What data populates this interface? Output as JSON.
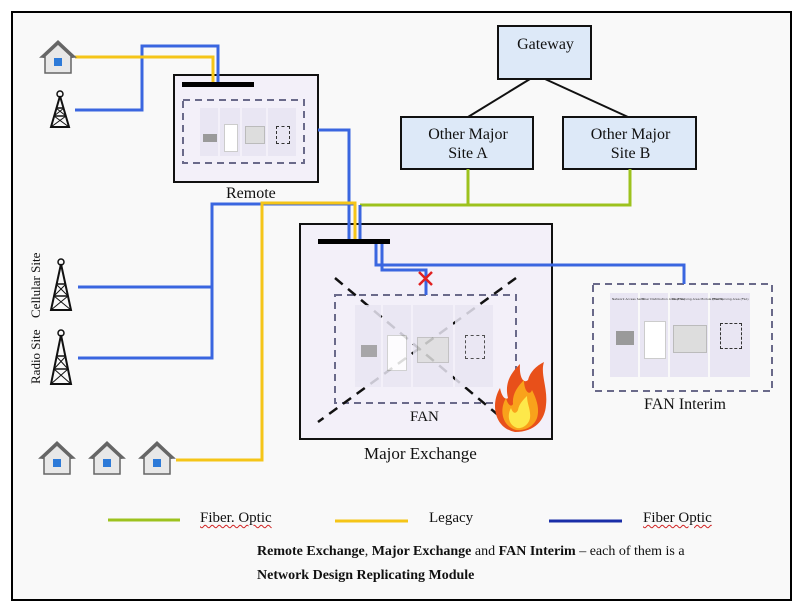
{
  "nodes": {
    "gateway": "Gateway",
    "site_a": [
      "Other Major",
      "Site A"
    ],
    "site_b": [
      "Other Major",
      "Site B"
    ],
    "remote": "Remote",
    "major_exchange": "Major Exchange",
    "fan": "FAN",
    "fan_interim": "FAN Interim",
    "cellular_site": "Cellular Site",
    "radio_site": "Radio Site"
  },
  "module_columns": [
    "Network Access Seite",
    "Fiber Distribution Area (FDA)",
    "Fiber Serving Area Module (FSAM)",
    "Fiber Serving Area (FSA)"
  ],
  "legend": [
    {
      "label": "Fiber. Optic",
      "color": "#9dc21e"
    },
    {
      "label": "Legacy",
      "color": "#f5c518"
    },
    {
      "label": "Fiber Optic",
      "color": "#1a2ea8"
    }
  ],
  "caption": {
    "part1_bold": "Remote Exchange",
    "sep1": ", ",
    "part2_bold": "Major Exchange",
    "and": " and ",
    "part3_bold": "FAN Interim",
    "rest": " – each of them is a",
    "line2_bold": "Network Design Replicating Module"
  },
  "colors": {
    "fiber_blue": "#3a66e0",
    "legacy_yellow": "#f5c518",
    "fiber_green": "#9dc21e",
    "box_fill": "#dde9f8",
    "exchange_fill": "#f3f0f9",
    "failure_x": "#e02020"
  }
}
